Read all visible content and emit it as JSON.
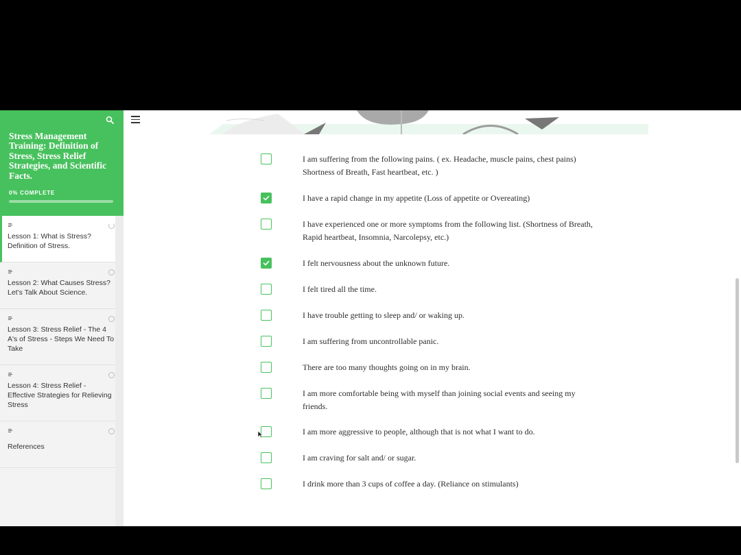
{
  "course": {
    "title": "Stress Management Training: Definition of Stress, Stress Relief Strategies, and Scientific Facts.",
    "progress_label": "0% COMPLETE",
    "progress_percent": 0
  },
  "lessons": [
    {
      "label": "Lesson 1: What is Stress? Definition of Stress.",
      "active": true,
      "status": "in-progress"
    },
    {
      "label": "Lesson 2: What Causes Stress? Let's Talk About Science.",
      "active": false,
      "status": "not-started"
    },
    {
      "label": "Lesson 3: Stress Relief - The 4 A's of Stress - Steps We Need To Take",
      "active": false,
      "status": "not-started"
    },
    {
      "label": "Lesson 4: Stress Relief - Effective Strategies for Relieving Stress",
      "active": false,
      "status": "not-started"
    },
    {
      "label": "References",
      "active": false,
      "status": "not-started"
    }
  ],
  "checklist": [
    {
      "text": "I  am suffering from the following pains. ( ex. Headache, muscle pains,  chest pains)  Shortness of Breath, Fast heartbeat, etc. )",
      "checked": false
    },
    {
      "text": "I have a rapid change in my appetite (Loss of appetite or Overeating)",
      "checked": true
    },
    {
      "text": "I have experienced one or more symptoms from the following list. (Shortness of Breath, Rapid heartbeat, Insomnia, Narcolepsy, etc.)",
      "checked": false
    },
    {
      "text": "I felt nervousness about the unknown future.",
      "checked": true
    },
    {
      "text": "I felt tired all the time.",
      "checked": false
    },
    {
      "text": "I have trouble getting to sleep and/ or waking up.",
      "checked": false
    },
    {
      "text": "I am suffering from uncontrollable panic.",
      "checked": false
    },
    {
      "text": "There are too many thoughts going on in my brain.",
      "checked": false
    },
    {
      "text": "I am more comfortable being with myself than joining social events and seeing my friends.",
      "checked": false
    },
    {
      "text": "I am more aggressive to people, although that is not what I want to do.",
      "checked": false
    },
    {
      "text": "I am craving for salt and/ or sugar.",
      "checked": false
    },
    {
      "text": "I drink more than 3 cups of coffee a day. (Reliance on stimulants)",
      "checked": false
    }
  ],
  "colors": {
    "accent": "#47c15d",
    "sidebar_bg": "#f3f3f3",
    "text": "#2c2c2c"
  },
  "icons": {
    "search": "search-icon",
    "menu": "hamburger-menu-icon",
    "check": "checkmark-icon",
    "lesson_type": "text-lines-icon",
    "status": "status-circle-icon"
  }
}
